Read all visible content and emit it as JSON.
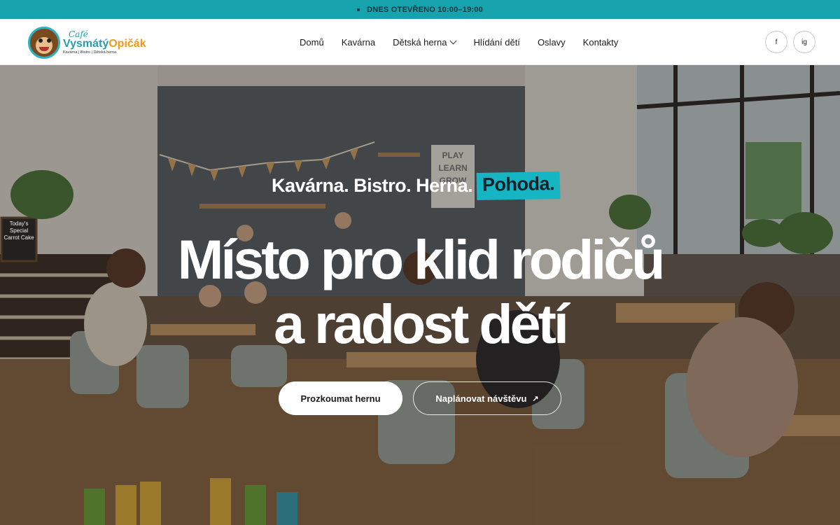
{
  "topbar": {
    "text": "DNES OTEVŘENO 10:00–19:00"
  },
  "logo": {
    "cafe": "Café",
    "name_part1": "Vysmátý",
    "name_part2": "Opičák",
    "subtitle": "Kavárna | Bistro | Dětská herna"
  },
  "nav": {
    "items": [
      {
        "label": "Domů"
      },
      {
        "label": "Kavárna"
      },
      {
        "label": "Dětská herna",
        "has_dropdown": true
      },
      {
        "label": "Hlídání dětí"
      },
      {
        "label": "Oslavy"
      },
      {
        "label": "Kontakty"
      }
    ]
  },
  "social": {
    "facebook": "f",
    "instagram": "ig"
  },
  "hero": {
    "tagline": "Kavárna. Bistro. Herna.",
    "tagline_highlight": "Pohoda.",
    "headline_line1": "Místo pro klid rodičů",
    "headline_line2": "a radost dětí",
    "primary_button": "Prozkoumat hernu",
    "secondary_button": "Naplánovat návštěvu",
    "secondary_icon": "arrow-up-right-icon",
    "chalkboard": "Today's Special Carrot Cake",
    "wall_sign": "PLAY LEARN GROW"
  },
  "colors": {
    "accent": "#16a3ad",
    "highlight": "#16b5c3",
    "logo_orange": "#f09a1a"
  }
}
